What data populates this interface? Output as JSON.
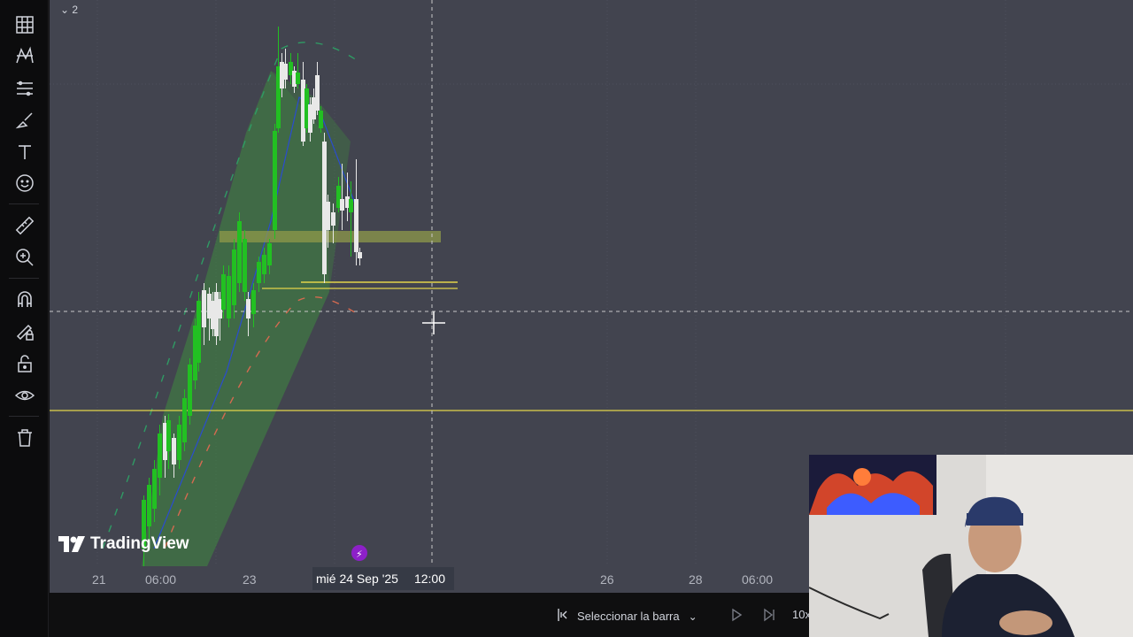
{
  "app": {
    "logo_text": "TradingView"
  },
  "legend": {
    "toggle_label": "2"
  },
  "toolbar": {
    "tools": [
      "grid-icon",
      "pattern-icon",
      "fib-icon",
      "brush-icon",
      "text-icon",
      "emoji-icon",
      "ruler-icon",
      "zoom-in-icon",
      "magnet-icon",
      "lock-drawing-icon",
      "lock-icon",
      "eye-icon",
      "trash-icon"
    ]
  },
  "time_axis": {
    "labels": [
      "21",
      "06:00",
      "23",
      "26",
      "28",
      "06:00"
    ],
    "crosshair_date": "mié 24 Sep '25",
    "crosshair_time": "12:00"
  },
  "bottom_bar": {
    "select_bar_label": "Seleccionar la barra",
    "replay_speed": "10x"
  },
  "colors": {
    "background": "#42444f",
    "up_candle": "#22c022",
    "down_candle": "#e8e8e8",
    "level_line": "#e3d44a",
    "band_fill": "#3f8a3f"
  }
}
